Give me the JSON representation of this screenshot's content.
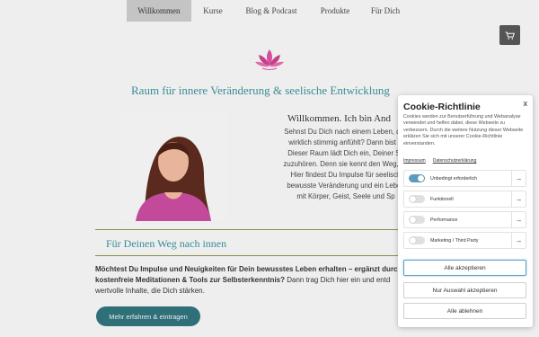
{
  "nav": {
    "items": [
      "Willkommen",
      "Kurse",
      "Blog & Podcast",
      "Produkte",
      "Für Dich"
    ],
    "active_index": 0
  },
  "cart": {
    "icon": "cart-icon"
  },
  "hero": {
    "tagline": "Raum für innere Veränderung & seelische Entwicklung",
    "welcome_title": "Willkommen. Ich bin And",
    "welcome_lines": [
      "Sehnst Du Dich nach einem Leben, das",
      "wirklich stimmig anfühlt? Dann bist D",
      "Dieser Raum lädt Dich ein, Deiner Se",
      "zuzuhören. Denn sie kennt den Weg, de",
      "Hier findest Du Impulse für seelisch",
      "bewusste Veränderung und ein Leben",
      "mit Körper, Geist, Seele und Sp"
    ]
  },
  "section": {
    "title": "Für Deinen Weg nach innen",
    "intro_bold": "Möchtest Du Impulse und Neuigkeiten für Dein bewusstes Leben erhalten – ergänzt durch kostenfreie Meditationen & Tools zur Selbsterkenntnis?",
    "intro_rest": " Dann trag Dich hier ein und entd wertvolle Inhalte, die Dich stärken.",
    "cta_label": "Mehr erfahren & eintragen"
  },
  "cookie": {
    "title": "Cookie-Richtlinie",
    "close": "x",
    "text": "Cookies werden zur Benutzerführung und Webanalyse verwendet und helfen dabei, diese Webseite zu verbessern. Durch die weitere Nutzung dieser Webseite erklären Sie sich mit unserer Cookie-Richtlinie einverstanden.",
    "links": [
      "Impressum",
      "Datenschutzerklärung"
    ],
    "categories": [
      {
        "label": "Unbedingt erforderlich",
        "enabled": true
      },
      {
        "label": "Funktionell",
        "enabled": false
      },
      {
        "label": "Performance",
        "enabled": false
      },
      {
        "label": "Marketing / Third Party",
        "enabled": false
      }
    ],
    "arrow": "→",
    "buttons": {
      "accept_all": "Alle akzeptieren",
      "accept_selection": "Nur Auswahl akzeptieren",
      "reject_all": "Alle ablehnen"
    }
  },
  "colors": {
    "accent": "#3a8c97",
    "button": "#2f6f78",
    "toggle_on": "#5a9cc0",
    "lotus": "#d64f9a"
  }
}
